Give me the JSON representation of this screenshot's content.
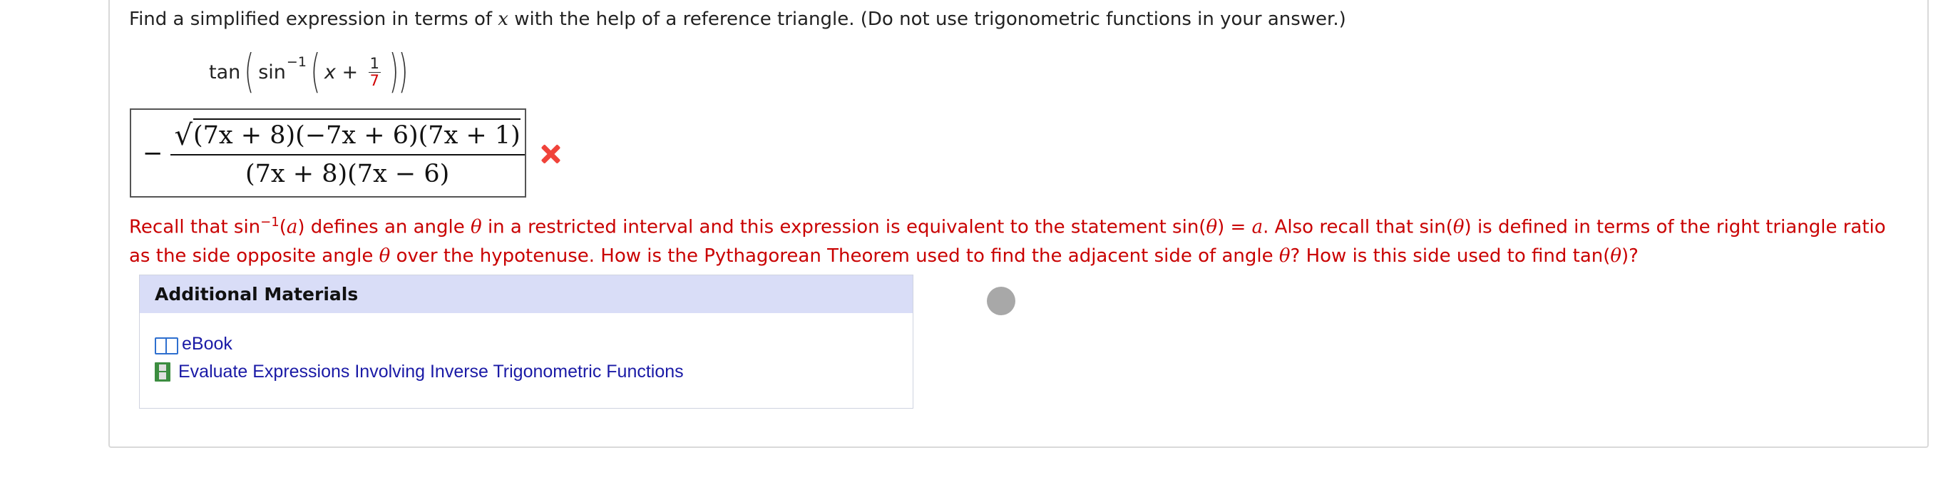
{
  "question": {
    "prompt_before": "Find a simplified expression in terms of ",
    "prompt_var": "x",
    "prompt_after": " with the help of a reference triangle. (Do not use trigonometric functions in your answer.)",
    "expr_func": "tan",
    "expr_inner": "sin",
    "expr_sup": "−1",
    "expr_x": "x",
    "expr_plus": " + ",
    "expr_num": "1",
    "expr_den": "7"
  },
  "answer": {
    "sign": "−",
    "radical": "√",
    "radicand": "(7x + 8)(−7x + 6)(7x + 1)",
    "denominator": "(7x + 8)(7x − 6)",
    "status_icon": "cross-icon",
    "status_color": "#f0433a"
  },
  "feedback": {
    "p1": "Recall that sin",
    "p1_sup": "−1",
    "p2": "(",
    "a1": "a",
    "p3": ") defines an angle ",
    "theta1": "θ",
    "p4": " in a restricted interval and this expression is equivalent to the statement sin(",
    "theta2": "θ",
    "p5": ") = ",
    "a2": "a",
    "p6": ". Also recall that sin(",
    "theta3": "θ",
    "p7": ") is defined in terms of the right triangle ratio as the side opposite angle ",
    "theta4": "θ",
    "p8": " over the hypotenuse. How is the Pythagorean Theorem used to find the adjacent side of angle ",
    "theta5": "θ",
    "p9": "? How is this side used to find tan(",
    "theta6": "θ",
    "p10": ")?",
    "color": "#c90000"
  },
  "materials": {
    "header": "Additional Materials",
    "items": [
      {
        "label": "eBook",
        "icon": "book-icon"
      },
      {
        "label": "Evaluate Expressions Involving Inverse Trigonometric Functions",
        "icon": "film-icon"
      }
    ],
    "header_bg": "#d9ddf7",
    "link_color": "#1a1aa6"
  }
}
